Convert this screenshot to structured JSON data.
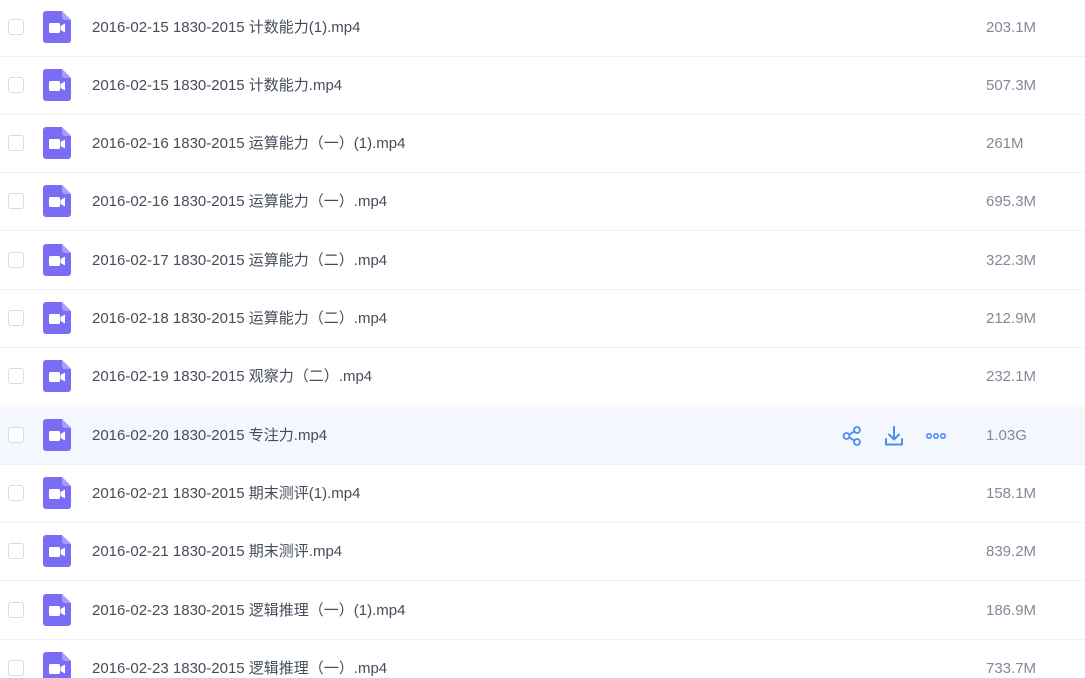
{
  "colors": {
    "video_icon": "#7b6cf6",
    "action_icon": "#4a8cf0",
    "hover_row": "#f4f7fd"
  },
  "icons": {
    "file_type": "video-file-icon",
    "share": "share-icon",
    "download": "download-icon",
    "more": "more-icon"
  },
  "files": [
    {
      "name": "2016-02-15 1830-2015 计数能力(1).mp4",
      "size": "203.1M"
    },
    {
      "name": "2016-02-15 1830-2015 计数能力.mp4",
      "size": "507.3M"
    },
    {
      "name": "2016-02-16 1830-2015 运算能力（一）(1).mp4",
      "size": "261M"
    },
    {
      "name": "2016-02-16 1830-2015 运算能力（一）.mp4",
      "size": "695.3M"
    },
    {
      "name": "2016-02-17 1830-2015 运算能力（二）.mp4",
      "size": "322.3M"
    },
    {
      "name": "2016-02-18 1830-2015 运算能力（二）.mp4",
      "size": "212.9M"
    },
    {
      "name": "2016-02-19 1830-2015 观察力（二）.mp4",
      "size": "232.1M"
    },
    {
      "name": "2016-02-20 1830-2015 专注力.mp4",
      "size": "1.03G",
      "hovered": true
    },
    {
      "name": "2016-02-21 1830-2015 期末测评(1).mp4",
      "size": "158.1M"
    },
    {
      "name": "2016-02-21 1830-2015 期末测评.mp4",
      "size": "839.2M"
    },
    {
      "name": "2016-02-23 1830-2015 逻辑推理（一）(1).mp4",
      "size": "186.9M"
    },
    {
      "name": "2016-02-23 1830-2015 逻辑推理（一）.mp4",
      "size": "733.7M"
    }
  ]
}
